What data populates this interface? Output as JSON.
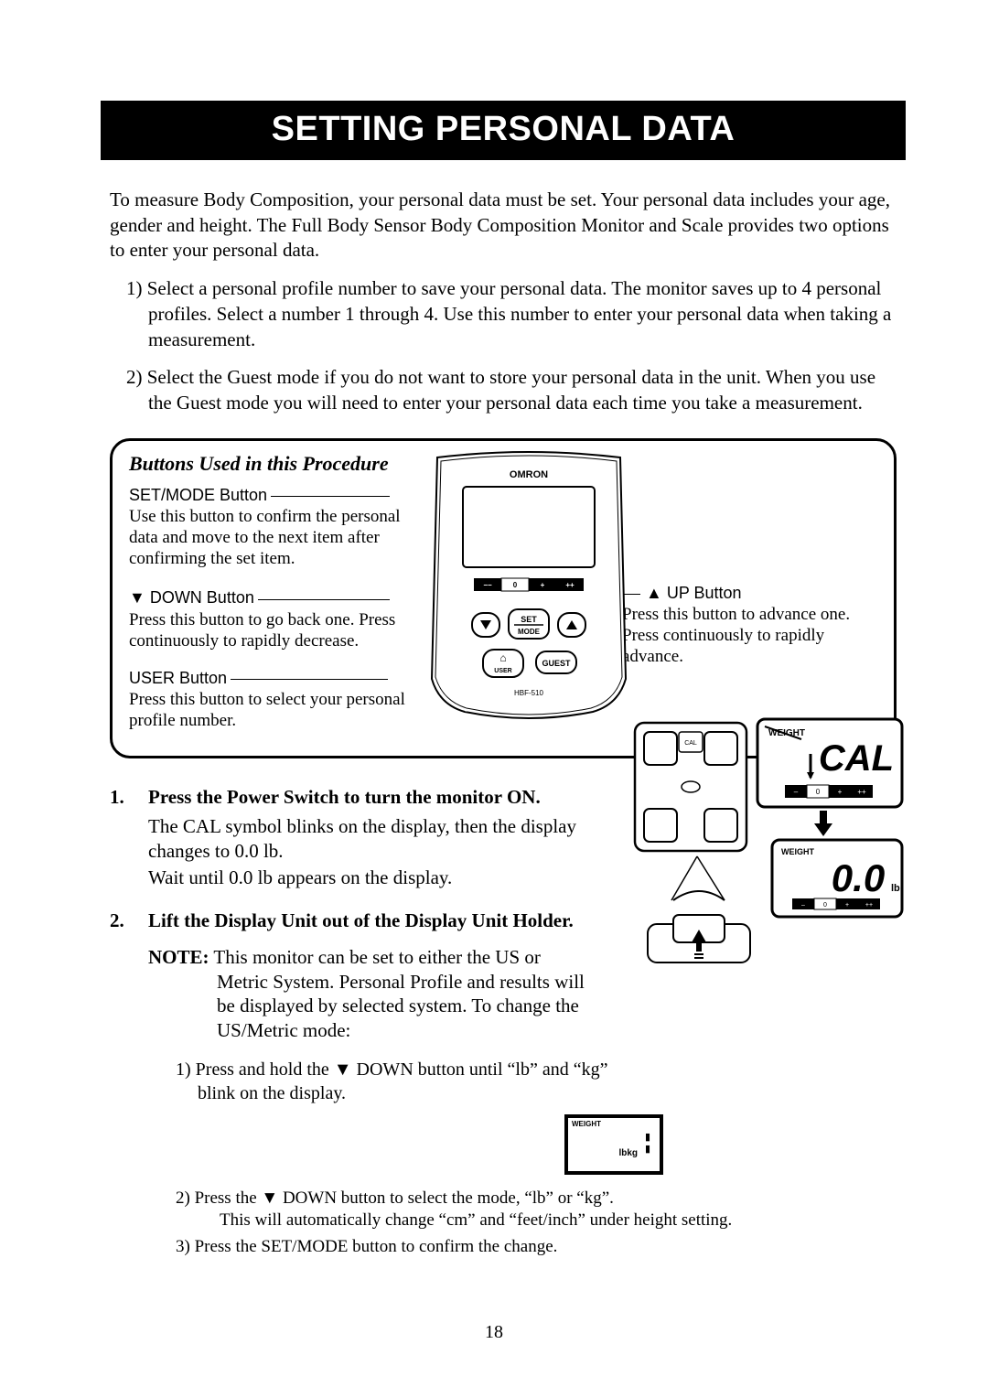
{
  "title": "SETTING PERSONAL DATA",
  "intro": "To measure Body Composition, your personal data must be set. Your personal data includes your age, gender and height. The Full Body Sensor Body Composition Monitor and Scale provides two options to enter your personal data.",
  "options": [
    "1) Select a personal profile number to save your personal data. The monitor saves up to 4 personal profiles. Select a number 1 through 4. Use this number to enter your personal data when taking a measurement.",
    "2) Select the Guest mode if you do not want to store your personal data in the unit. When you use the Guest mode you will need to enter your personal data each time you take a measurement."
  ],
  "box": {
    "title": "Buttons Used in this Procedure",
    "set": {
      "head": "SET/MODE Button",
      "body": "Use this button to confirm the personal data and move to the next item after confirming the set item."
    },
    "down": {
      "head": "▼ DOWN Button",
      "body": "Press this button to go back one. Press continuously to rapidly decrease."
    },
    "user": {
      "head": "USER Button",
      "body": "Press this button to select your personal profile number."
    },
    "up": {
      "head": "▲ UP Button",
      "body": "Press this button to advance one. Press continuously to rapidly advance."
    },
    "device": {
      "brand": "OMRON",
      "setmode_top": "SET",
      "setmode_bot": "MODE",
      "user_label": "USER",
      "guest_label": "GUEST",
      "model": "HBF-510",
      "bar_minus2": "−−",
      "bar_zero": "0",
      "bar_plus": "+",
      "bar_plus2": "++"
    }
  },
  "steps": {
    "s1": {
      "num": "1.",
      "title": "Press the Power Switch to turn the monitor ON.",
      "line1": "The CAL symbol blinks on the display, then the display changes to 0.0 lb.",
      "line2": "Wait until 0.0 lb appears on the display."
    },
    "s2": {
      "num": "2.",
      "title": "Lift the Display Unit out of the Display Unit Holder.",
      "note_label": "NOTE:",
      "note_body": " This monitor can be set to either the US or Metric System. Personal Profile and results will be displayed by selected system. To change the US/Metric mode:",
      "sub1a": "1) Press and hold the  ▼ DOWN button until “lb” and “kg” blink on the display.",
      "sub2a": "2) Press the  ▼ DOWN button to select the mode, “lb” or “kg”.",
      "sub2b": "This will automatically change “cm” and “feet/inch” under height setting.",
      "sub3a": "3) Press the SET/MODE button to confirm the change."
    }
  },
  "illus": {
    "weight_label": "WEIGHT",
    "cal": "CAL",
    "zero": "0.0",
    "lb": "lb",
    "lbkg": "lbkg",
    "bar_minus": "–",
    "bar_zero": "0",
    "bar_plus": "+",
    "bar_plus2": "++"
  },
  "page_number": "18"
}
